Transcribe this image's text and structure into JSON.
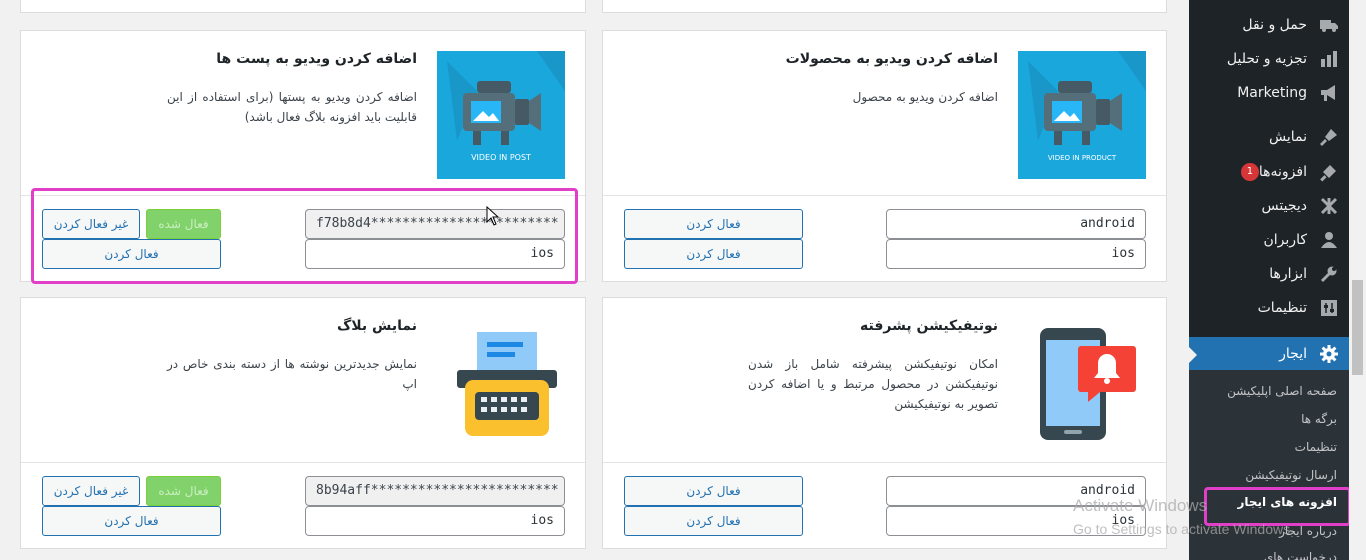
{
  "sidebar": {
    "items": [
      {
        "label": "حمل و نقل",
        "icon": "truck-icon"
      },
      {
        "label": "تجزیه و تحلیل",
        "icon": "bar-chart-icon"
      },
      {
        "label": "Marketing",
        "icon": "megaphone-icon"
      },
      {
        "label": "نمایش",
        "icon": "paintbrush-icon"
      },
      {
        "label": "افزونه‌ها",
        "icon": "plugin-icon",
        "badge": "1"
      },
      {
        "label": "دیجیتس",
        "icon": "digits-icon"
      },
      {
        "label": "کاربران",
        "icon": "user-icon"
      },
      {
        "label": "ابزارها",
        "icon": "wrench-icon"
      },
      {
        "label": "تنظیمات",
        "icon": "settings-sliders-icon"
      },
      {
        "label": "ایجار",
        "icon": "gear-icon"
      }
    ],
    "submenu": [
      "صفحه اصلی اپلیکیشن",
      "برگه ها",
      "تنظیمات",
      "ارسال نوتیفیکیشن",
      "افزونه های ایجار",
      "درباره ایجار",
      "درخواست های"
    ]
  },
  "cards": [
    {
      "title": "اضافه کردن ویدیو به پست ها",
      "desc": "اضافه کردن ویدیو به پستها (برای استفاده از این قابلیت باید افزونه بلاگ فعال باشد)",
      "image_caption": "VIDEO IN POST",
      "android_value": "f78b8d4************************",
      "ios_placeholder": "ios",
      "deactivate_label": "غیر فعال کردن",
      "activated_label": "فعال شده",
      "activate_label": "فعال کردن"
    },
    {
      "title": "اضافه کردن ویدیو به محصولات",
      "desc": "اضافه کردن ویدیو به محصول",
      "image_caption": "VIDEO IN PRODUCT",
      "android_placeholder": "android",
      "ios_placeholder": "ios",
      "activate_label": "فعال کردن"
    },
    {
      "title": "نمایش بلاگ",
      "desc": "نمایش جدیدترین نوشته ها از دسته بندی خاص در اپ",
      "android_value": "8b94aff************************",
      "ios_placeholder": "ios",
      "deactivate_label": "غیر فعال کردن",
      "activated_label": "فعال شده",
      "activate_label": "فعال کردن"
    },
    {
      "title": "نوتیفیکیشن پشرفته",
      "desc": "امکان نوتیفیکشن پیشرفته شامل باز شدن نوتیفیکشن در محصول مرتبط و یا اضافه کردن تصویر به نوتیفیکیشن",
      "android_placeholder": "android",
      "ios_placeholder": "ios",
      "activate_label": "فعال کردن"
    }
  ],
  "watermark": {
    "title": "Activate Windows",
    "subtitle": "Go to Settings to activate Windows."
  },
  "colors": {
    "sidebar_bg": "#1d2327",
    "accent": "#2271b1",
    "highlight": "#e23fc9",
    "activated_green": "#82d26b"
  }
}
